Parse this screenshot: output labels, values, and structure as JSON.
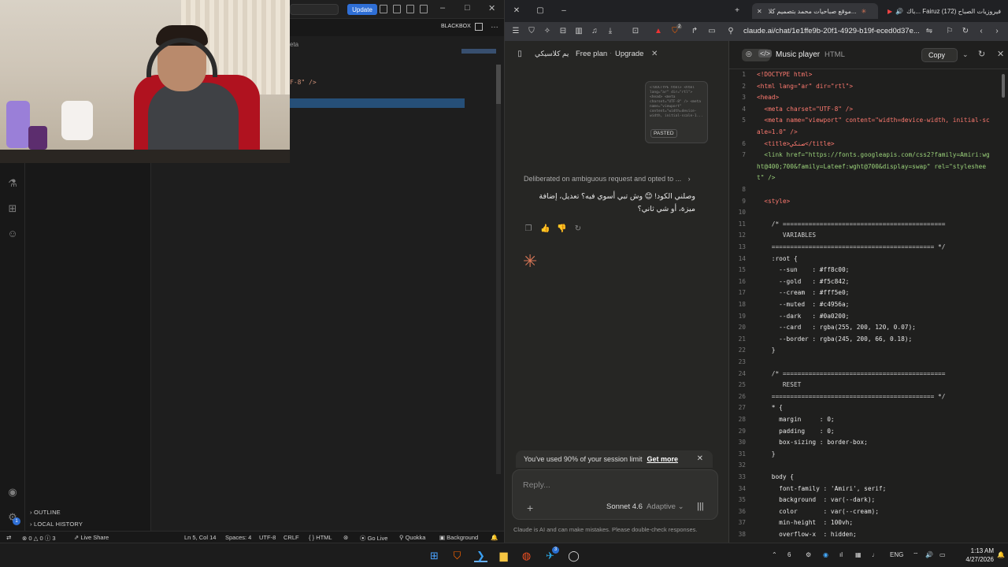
{
  "vscode": {
    "update_label": "Update",
    "blackbox_label": "BLACKBOX",
    "breadcrumb_partial": "eta",
    "code_partial": "F-8\" />",
    "sidebar": {
      "outline": "OUTLINE",
      "local_history": "LOCAL HISTORY"
    },
    "status": {
      "errors": "⊗ 0 △ 0 ⓘ 3",
      "live_share": "Live Share",
      "position": "Ln 5, Col 14",
      "spaces": "Spaces: 4",
      "encoding": "UTF-8",
      "eol": "CRLF",
      "language": "HTML",
      "go_live": "Go Live",
      "quokka": "Quokka",
      "background": "Background"
    },
    "badge_count": "1"
  },
  "browser": {
    "tabs": [
      {
        "label": "باك... Fairuz (172) فيروزيات الصباح",
        "active": false
      },
      {
        "label": "موقع صباحيات محمد بتصميم كلا...",
        "active": true
      }
    ],
    "url": "claude.ai/chat/1e1ffe9b-20f1-4929-b19f-eced0d37e...",
    "shield_badge": "2"
  },
  "chat": {
    "title_partial": "يم كلاسيكي",
    "free_plan": "Free plan",
    "upgrade": "Upgrade",
    "pasted_preview": "<!DOCTYPE html> <html lang=\"ar\" dir=\"rtl\"> <head> <meta charset=\"UTF-8\" /> <meta name=\"viewport\" content=\"width=device-width, initial-scale-1...",
    "pasted_badge": "PASTED",
    "thinking": "Deliberated on ambiguous request and opted to ...",
    "reply": "وصلني الكود! 😊 وش تبي أسوي فيه؟ تعديل، إضافة ميزة، أو شي ثاني؟",
    "limit_text": "You've used 90% of your session limit",
    "limit_link": "Get more",
    "input_placeholder": "Reply...",
    "model": "Sonnet 4.6",
    "mode": "Adaptive",
    "disclaimer": "Claude is AI and can make mistakes. Please double-check responses."
  },
  "artifact": {
    "title": "Music player",
    "type": "HTML",
    "copy_label": "Copy",
    "lines": [
      {
        "n": "1",
        "t": "<!DOCTYPE html>",
        "k": "tag"
      },
      {
        "n": "2",
        "t": "<html lang=\"ar\" dir=\"rtl\">",
        "k": "tag"
      },
      {
        "n": "3",
        "t": "<head>",
        "k": "tag"
      },
      {
        "n": "4",
        "t": "  <meta charset=\"UTF-8\" />",
        "k": "tag"
      },
      {
        "n": "5",
        "t": "  <meta name=\"viewport\" content=\"width=device-width, initial-sc",
        "k": "tag"
      },
      {
        "n": "",
        "t": "ale=1.0\" />",
        "k": "tag"
      },
      {
        "n": "6",
        "t": "  <title>صنكي</title>",
        "k": "tag"
      },
      {
        "n": "7",
        "t": "  <link href=\"https://fonts.googleapis.com/css2?family=Amiri:wg",
        "k": "str"
      },
      {
        "n": "",
        "t": "ht@400;700&family=Lateef:wght@700&display=swap\" rel=\"styleshee",
        "k": "str"
      },
      {
        "n": "",
        "t": "t\" />",
        "k": "str"
      },
      {
        "n": "8",
        "t": "",
        "k": "plain"
      },
      {
        "n": "9",
        "t": "  <style>",
        "k": "tag"
      },
      {
        "n": "10",
        "t": "",
        "k": "plain"
      },
      {
        "n": "11",
        "t": "    /* ============================================",
        "k": "com"
      },
      {
        "n": "12",
        "t": "       VARIABLES",
        "k": "com"
      },
      {
        "n": "13",
        "t": "    ============================================ */",
        "k": "com"
      },
      {
        "n": "14",
        "t": "    :root {",
        "k": "plain"
      },
      {
        "n": "15",
        "t": "      --sun    : #ff8c00;",
        "k": "plain"
      },
      {
        "n": "16",
        "t": "      --gold   : #f5c842;",
        "k": "plain"
      },
      {
        "n": "17",
        "t": "      --cream  : #fff5e0;",
        "k": "plain"
      },
      {
        "n": "18",
        "t": "      --muted  : #c4956a;",
        "k": "plain"
      },
      {
        "n": "19",
        "t": "      --dark   : #0a0200;",
        "k": "plain"
      },
      {
        "n": "20",
        "t": "      --card   : rgba(255, 200, 120, 0.07);",
        "k": "plain"
      },
      {
        "n": "21",
        "t": "      --border : rgba(245, 200, 66, 0.18);",
        "k": "plain"
      },
      {
        "n": "22",
        "t": "    }",
        "k": "plain"
      },
      {
        "n": "23",
        "t": "",
        "k": "plain"
      },
      {
        "n": "24",
        "t": "    /* ============================================",
        "k": "com"
      },
      {
        "n": "25",
        "t": "       RESET",
        "k": "com"
      },
      {
        "n": "26",
        "t": "    ============================================ */",
        "k": "com"
      },
      {
        "n": "27",
        "t": "    * {",
        "k": "plain"
      },
      {
        "n": "28",
        "t": "      margin     : 0;",
        "k": "plain"
      },
      {
        "n": "29",
        "t": "      padding    : 0;",
        "k": "plain"
      },
      {
        "n": "30",
        "t": "      box-sizing : border-box;",
        "k": "plain"
      },
      {
        "n": "31",
        "t": "    }",
        "k": "plain"
      },
      {
        "n": "32",
        "t": "",
        "k": "plain"
      },
      {
        "n": "33",
        "t": "    body {",
        "k": "plain"
      },
      {
        "n": "34",
        "t": "      font-family : 'Amiri', serif;",
        "k": "plain"
      },
      {
        "n": "35",
        "t": "      background  : var(--dark);",
        "k": "plain"
      },
      {
        "n": "36",
        "t": "      color       : var(--cream);",
        "k": "plain"
      },
      {
        "n": "37",
        "t": "      min-height  : 100vh;",
        "k": "plain"
      },
      {
        "n": "38",
        "t": "      overflow-x  : hidden;",
        "k": "plain"
      }
    ]
  },
  "taskbar": {
    "language": "ENG",
    "time": "1:13 AM",
    "date": "4/27/2026",
    "telegram_badge": "3"
  }
}
